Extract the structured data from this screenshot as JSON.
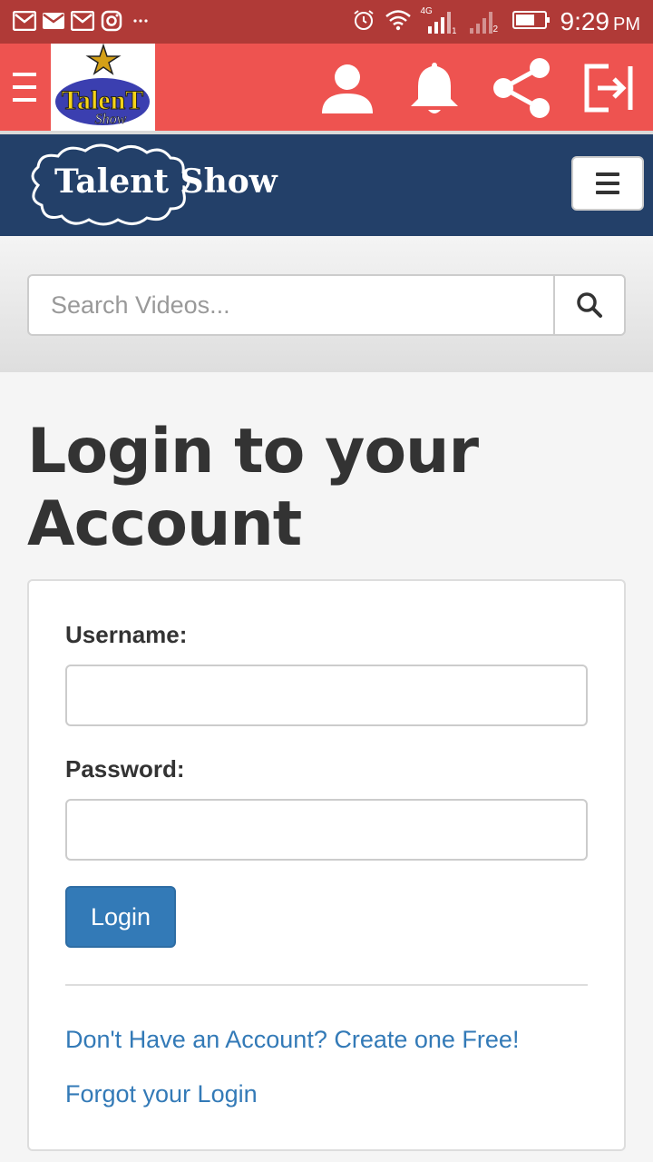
{
  "status_bar": {
    "time": "9:29",
    "ampm": "PM",
    "network_label": "4G",
    "sim2_label": "2",
    "icons": [
      "gmail-icon",
      "email-icon",
      "gmail-icon",
      "instagram-icon",
      "more-icon",
      "alarm-icon",
      "wifi-icon",
      "signal-icon",
      "signal-icon",
      "battery-icon"
    ]
  },
  "app_bar": {
    "logo_text": "TalenT",
    "logo_subtext": "Show",
    "actions": [
      "user-icon",
      "bell-icon",
      "share-icon",
      "logout-icon"
    ],
    "background": "#ee5350"
  },
  "site_nav": {
    "brand": "Talent Show",
    "background": "#234069"
  },
  "search": {
    "placeholder": "Search Videos..."
  },
  "page": {
    "title_line1": "Login to your",
    "title_line2": "Account"
  },
  "form": {
    "username_label": "Username:",
    "username_value": "",
    "password_label": "Password:",
    "password_value": "",
    "login_label": "Login",
    "signup_link": "Don't Have an Account? Create one Free!",
    "forgot_link": "Forgot your Login"
  },
  "colors": {
    "primary": "#337ab7",
    "status_bar": "#b03a37"
  }
}
